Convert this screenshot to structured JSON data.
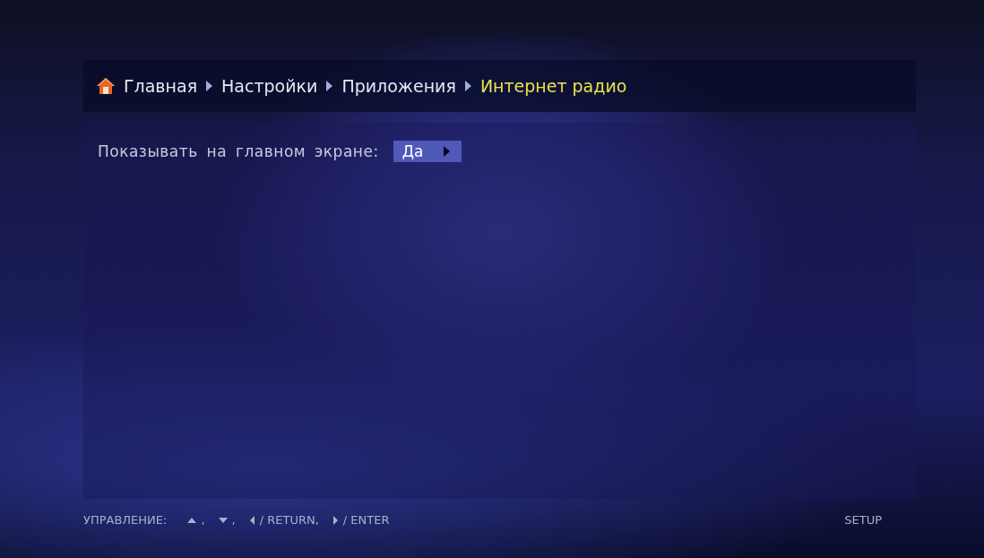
{
  "breadcrumb": [
    {
      "label": "Главная",
      "current": false
    },
    {
      "label": "Настройки",
      "current": false
    },
    {
      "label": "Приложения",
      "current": false
    },
    {
      "label": "Интернет  радио",
      "current": true
    }
  ],
  "settings": [
    {
      "label": "Показывать на главном экране:",
      "value": "Да",
      "focused": true
    }
  ],
  "footer": {
    "label": "УПРАВЛЕНИЕ:",
    "keys": [
      {
        "kind": "up",
        "text": ","
      },
      {
        "kind": "down",
        "text": ","
      },
      {
        "kind": "left",
        "text": "/ RETURN,"
      },
      {
        "kind": "right",
        "text": "/ ENTER"
      }
    ],
    "section": "SETUP"
  }
}
